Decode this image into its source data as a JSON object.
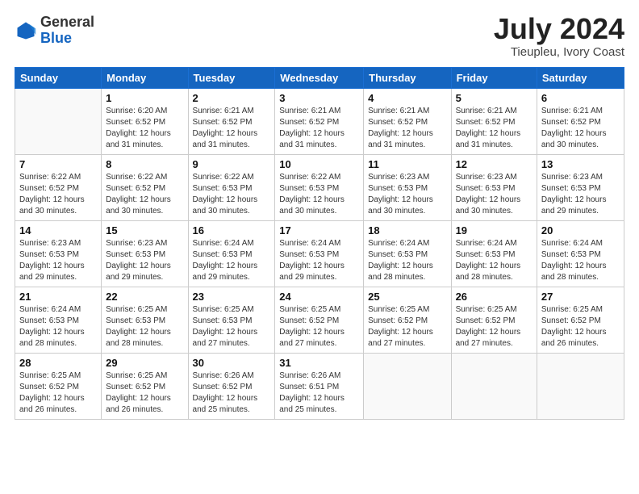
{
  "header": {
    "logo_general": "General",
    "logo_blue": "Blue",
    "title": "July 2024",
    "location": "Tieupleu, Ivory Coast"
  },
  "weekdays": [
    "Sunday",
    "Monday",
    "Tuesday",
    "Wednesday",
    "Thursday",
    "Friday",
    "Saturday"
  ],
  "weeks": [
    [
      {
        "day": "",
        "info": ""
      },
      {
        "day": "1",
        "info": "Sunrise: 6:20 AM\nSunset: 6:52 PM\nDaylight: 12 hours\nand 31 minutes."
      },
      {
        "day": "2",
        "info": "Sunrise: 6:21 AM\nSunset: 6:52 PM\nDaylight: 12 hours\nand 31 minutes."
      },
      {
        "day": "3",
        "info": "Sunrise: 6:21 AM\nSunset: 6:52 PM\nDaylight: 12 hours\nand 31 minutes."
      },
      {
        "day": "4",
        "info": "Sunrise: 6:21 AM\nSunset: 6:52 PM\nDaylight: 12 hours\nand 31 minutes."
      },
      {
        "day": "5",
        "info": "Sunrise: 6:21 AM\nSunset: 6:52 PM\nDaylight: 12 hours\nand 31 minutes."
      },
      {
        "day": "6",
        "info": "Sunrise: 6:21 AM\nSunset: 6:52 PM\nDaylight: 12 hours\nand 30 minutes."
      }
    ],
    [
      {
        "day": "7",
        "info": "Sunrise: 6:22 AM\nSunset: 6:52 PM\nDaylight: 12 hours\nand 30 minutes."
      },
      {
        "day": "8",
        "info": "Sunrise: 6:22 AM\nSunset: 6:52 PM\nDaylight: 12 hours\nand 30 minutes."
      },
      {
        "day": "9",
        "info": "Sunrise: 6:22 AM\nSunset: 6:53 PM\nDaylight: 12 hours\nand 30 minutes."
      },
      {
        "day": "10",
        "info": "Sunrise: 6:22 AM\nSunset: 6:53 PM\nDaylight: 12 hours\nand 30 minutes."
      },
      {
        "day": "11",
        "info": "Sunrise: 6:23 AM\nSunset: 6:53 PM\nDaylight: 12 hours\nand 30 minutes."
      },
      {
        "day": "12",
        "info": "Sunrise: 6:23 AM\nSunset: 6:53 PM\nDaylight: 12 hours\nand 30 minutes."
      },
      {
        "day": "13",
        "info": "Sunrise: 6:23 AM\nSunset: 6:53 PM\nDaylight: 12 hours\nand 29 minutes."
      }
    ],
    [
      {
        "day": "14",
        "info": "Sunrise: 6:23 AM\nSunset: 6:53 PM\nDaylight: 12 hours\nand 29 minutes."
      },
      {
        "day": "15",
        "info": "Sunrise: 6:23 AM\nSunset: 6:53 PM\nDaylight: 12 hours\nand 29 minutes."
      },
      {
        "day": "16",
        "info": "Sunrise: 6:24 AM\nSunset: 6:53 PM\nDaylight: 12 hours\nand 29 minutes."
      },
      {
        "day": "17",
        "info": "Sunrise: 6:24 AM\nSunset: 6:53 PM\nDaylight: 12 hours\nand 29 minutes."
      },
      {
        "day": "18",
        "info": "Sunrise: 6:24 AM\nSunset: 6:53 PM\nDaylight: 12 hours\nand 28 minutes."
      },
      {
        "day": "19",
        "info": "Sunrise: 6:24 AM\nSunset: 6:53 PM\nDaylight: 12 hours\nand 28 minutes."
      },
      {
        "day": "20",
        "info": "Sunrise: 6:24 AM\nSunset: 6:53 PM\nDaylight: 12 hours\nand 28 minutes."
      }
    ],
    [
      {
        "day": "21",
        "info": "Sunrise: 6:24 AM\nSunset: 6:53 PM\nDaylight: 12 hours\nand 28 minutes."
      },
      {
        "day": "22",
        "info": "Sunrise: 6:25 AM\nSunset: 6:53 PM\nDaylight: 12 hours\nand 28 minutes."
      },
      {
        "day": "23",
        "info": "Sunrise: 6:25 AM\nSunset: 6:53 PM\nDaylight: 12 hours\nand 27 minutes."
      },
      {
        "day": "24",
        "info": "Sunrise: 6:25 AM\nSunset: 6:52 PM\nDaylight: 12 hours\nand 27 minutes."
      },
      {
        "day": "25",
        "info": "Sunrise: 6:25 AM\nSunset: 6:52 PM\nDaylight: 12 hours\nand 27 minutes."
      },
      {
        "day": "26",
        "info": "Sunrise: 6:25 AM\nSunset: 6:52 PM\nDaylight: 12 hours\nand 27 minutes."
      },
      {
        "day": "27",
        "info": "Sunrise: 6:25 AM\nSunset: 6:52 PM\nDaylight: 12 hours\nand 26 minutes."
      }
    ],
    [
      {
        "day": "28",
        "info": "Sunrise: 6:25 AM\nSunset: 6:52 PM\nDaylight: 12 hours\nand 26 minutes."
      },
      {
        "day": "29",
        "info": "Sunrise: 6:25 AM\nSunset: 6:52 PM\nDaylight: 12 hours\nand 26 minutes."
      },
      {
        "day": "30",
        "info": "Sunrise: 6:26 AM\nSunset: 6:52 PM\nDaylight: 12 hours\nand 25 minutes."
      },
      {
        "day": "31",
        "info": "Sunrise: 6:26 AM\nSunset: 6:51 PM\nDaylight: 12 hours\nand 25 minutes."
      },
      {
        "day": "",
        "info": ""
      },
      {
        "day": "",
        "info": ""
      },
      {
        "day": "",
        "info": ""
      }
    ]
  ]
}
